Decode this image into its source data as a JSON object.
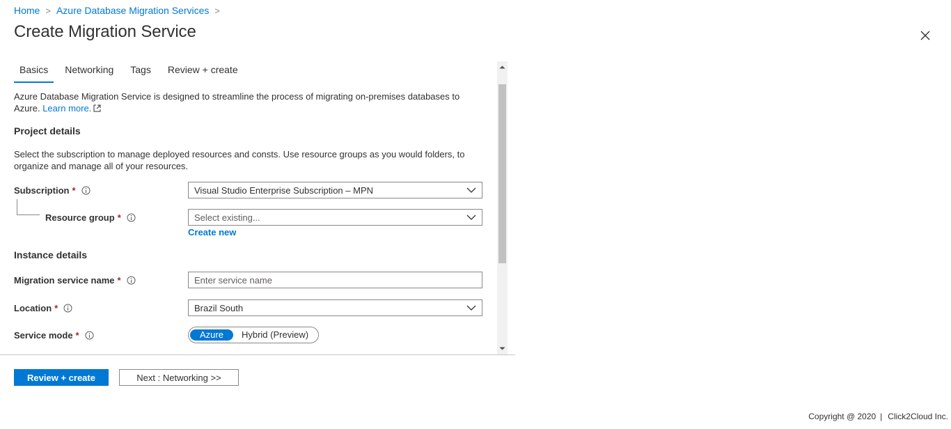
{
  "breadcrumb": {
    "items": [
      "Home",
      "Azure Database Migration Services"
    ],
    "separator": ">"
  },
  "page": {
    "title": "Create Migration Service"
  },
  "tabs": [
    {
      "label": "Basics",
      "active": true
    },
    {
      "label": "Networking",
      "active": false
    },
    {
      "label": "Tags",
      "active": false
    },
    {
      "label": "Review + create",
      "active": false
    }
  ],
  "intro": {
    "text": "Azure Database Migration Service is designed to streamline the process of migrating on-premises databases to Azure.",
    "learn_more": "Learn more."
  },
  "project_details": {
    "heading": "Project details",
    "description": "Select the subscription to manage deployed resources and consts. Use resource groups as you would folders, to organize and manage all of your resources."
  },
  "fields": {
    "subscription": {
      "label": "Subscription",
      "value": "Visual Studio Enterprise Subscription – MPN"
    },
    "resource_group": {
      "label": "Resource group",
      "placeholder": "Select existing...",
      "create_new": "Create new"
    },
    "migration_service_name": {
      "label": "Migration service name",
      "placeholder": "Enter service name",
      "value": ""
    },
    "location": {
      "label": "Location",
      "value": "Brazil South"
    },
    "service_mode": {
      "label": "Service mode",
      "options": [
        "Azure",
        "Hybrid (Preview)"
      ],
      "selected": "Azure"
    }
  },
  "instance_details": {
    "heading": "Instance details"
  },
  "required_marker": "*",
  "actions": {
    "review_create": "Review + create",
    "next": "Next : Networking >>"
  },
  "footer": {
    "copyright": "Copyright @ 2020",
    "separator": "|",
    "company": "Click2Cloud Inc."
  },
  "colors": {
    "accent": "#0078d4",
    "required": "#a4262c",
    "text": "#323130",
    "border": "#8a8886"
  },
  "icons": {
    "info": "info-icon",
    "chevron": "chevron-down-icon",
    "close": "close-icon",
    "external_link": "external-link-icon"
  }
}
